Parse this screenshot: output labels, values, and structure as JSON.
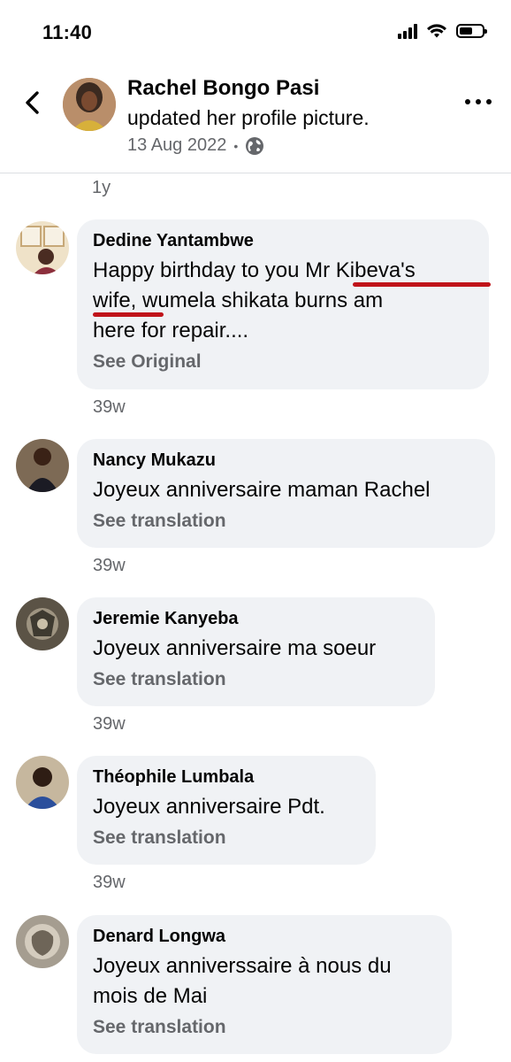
{
  "status_bar": {
    "time": "11:40",
    "icons": [
      "signal-icon",
      "wifi-icon",
      "battery-icon"
    ]
  },
  "header": {
    "name": "Rachel Bongo Pasi",
    "action": "updated her profile picture.",
    "date": "13 Aug 2022",
    "separator": "•",
    "privacy_icon": "globe-icon"
  },
  "top_timestamp": "1y",
  "comments": [
    {
      "name": "Dedine Yantambwe",
      "lines": [
        "Happy birthday to you Mr Kibeva's",
        "wife, wumela shikata burns am",
        "here for repair...."
      ],
      "link": "See Original",
      "time": "39w",
      "annotation_color": "#c0141a"
    },
    {
      "name": "Nancy Mukazu",
      "lines": [
        "Joyeux anniversaire maman Rachel"
      ],
      "link": "See translation",
      "time": "39w"
    },
    {
      "name": "Jeremie Kanyeba",
      "lines": [
        "Joyeux anniversaire ma soeur"
      ],
      "link": "See translation",
      "time": "39w"
    },
    {
      "name": "Théophile Lumbala",
      "lines": [
        "Joyeux anniversaire Pdt."
      ],
      "link": "See translation",
      "time": "39w"
    },
    {
      "name": "Denard Longwa",
      "lines": [
        "Joyeux anniverssaire à nous du",
        "mois de Mai"
      ],
      "link": "See translation"
    }
  ],
  "colors": {
    "bubble": "#f0f2f5",
    "secondary_text": "#65676b",
    "primary_text": "#050505"
  }
}
